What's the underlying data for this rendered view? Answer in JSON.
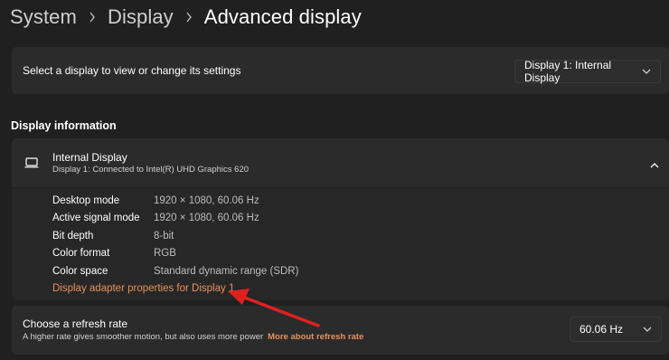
{
  "breadcrumb": {
    "items": [
      "System",
      "Display"
    ],
    "current": "Advanced display"
  },
  "select_display": {
    "label": "Select a display to view or change its settings",
    "dropdown_value": "Display 1: Internal Display"
  },
  "display_information": {
    "section_title": "Display information",
    "name": "Internal Display",
    "subtitle": "Display 1: Connected to Intel(R) UHD Graphics 620",
    "properties": [
      {
        "key": "Desktop mode",
        "value": "1920 × 1080, 60.06 Hz"
      },
      {
        "key": "Active signal mode",
        "value": "1920 × 1080, 60.06 Hz"
      },
      {
        "key": "Bit depth",
        "value": "8-bit"
      },
      {
        "key": "Color format",
        "value": "RGB"
      },
      {
        "key": "Color space",
        "value": "Standard dynamic range (SDR)"
      }
    ],
    "adapter_link": "Display adapter properties for Display 1"
  },
  "refresh_rate": {
    "title": "Choose a refresh rate",
    "description": "A higher rate gives smoother motion, but also uses more power",
    "link": "More about refresh rate",
    "dropdown_value": "60.06 Hz"
  },
  "icons": {
    "laptop": "laptop-icon",
    "chevron_up": "chevron-up-icon",
    "chevron_down": "chevron-down-icon",
    "chevron_right": "chevron-right-icon",
    "annotation_arrow": "red-arrow-annotation"
  },
  "colors": {
    "background": "#202020",
    "card": "#2b2b2b",
    "link": "#e8915a",
    "annotation": "#e02020"
  }
}
